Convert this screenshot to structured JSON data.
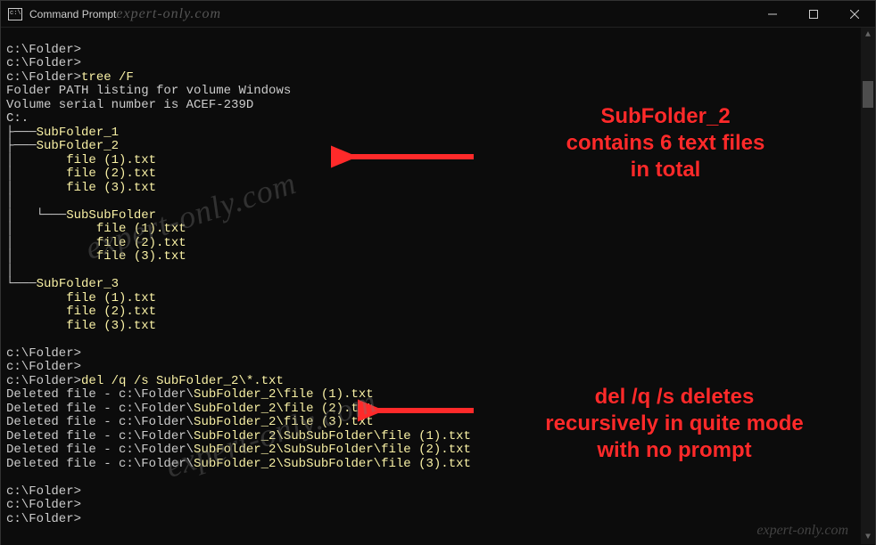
{
  "window": {
    "title": "Command Prompt",
    "watermark_title": "expert-only.com"
  },
  "terminal": {
    "prompt": "c:\\Folder>",
    "cmd_tree": "tree /F",
    "line_path_listing": "Folder PATH listing for volume Windows",
    "line_serial": "Volume serial number is ACEF-239D",
    "line_root": "C:.",
    "tree": {
      "sf1": "SubFolder_1",
      "sf2": "SubFolder_2",
      "sf2_f1": "file (1).txt",
      "sf2_f2": "file (2).txt",
      "sf2_f3": "file (3).txt",
      "ssf": "SubSubFolder",
      "ssf_f1": "file (1).txt",
      "ssf_f2": "file (2).txt",
      "ssf_f3": "file (3).txt",
      "sf3": "SubFolder_3",
      "sf3_f1": "file (1).txt",
      "sf3_f2": "file (2).txt",
      "sf3_f3": "file (3).txt"
    },
    "cmd_del": "del /q /s SubFolder_2\\*.txt",
    "deleted_prefix": "Deleted file - c:\\Folder\\",
    "del1": "SubFolder_2\\file (1).txt",
    "del2": "SubFolder_2\\file (2).txt",
    "del3": "SubFolder_2\\file (3).txt",
    "del4": "SubFolder_2\\SubSubFolder\\file (1).txt",
    "del5": "SubFolder_2\\SubSubFolder\\file (2).txt",
    "del6": "SubFolder_2\\SubSubFolder\\file (3).txt"
  },
  "annotations": {
    "top_l1": "SubFolder_2",
    "top_l2": "contains 6 text files",
    "top_l3": "in total",
    "bot_l1": "del /q /s deletes",
    "bot_l2": "recursively in quite mode",
    "bot_l3": "with no prompt"
  },
  "watermarks": {
    "big": "expert-only.com",
    "small": "expert-only.com"
  }
}
